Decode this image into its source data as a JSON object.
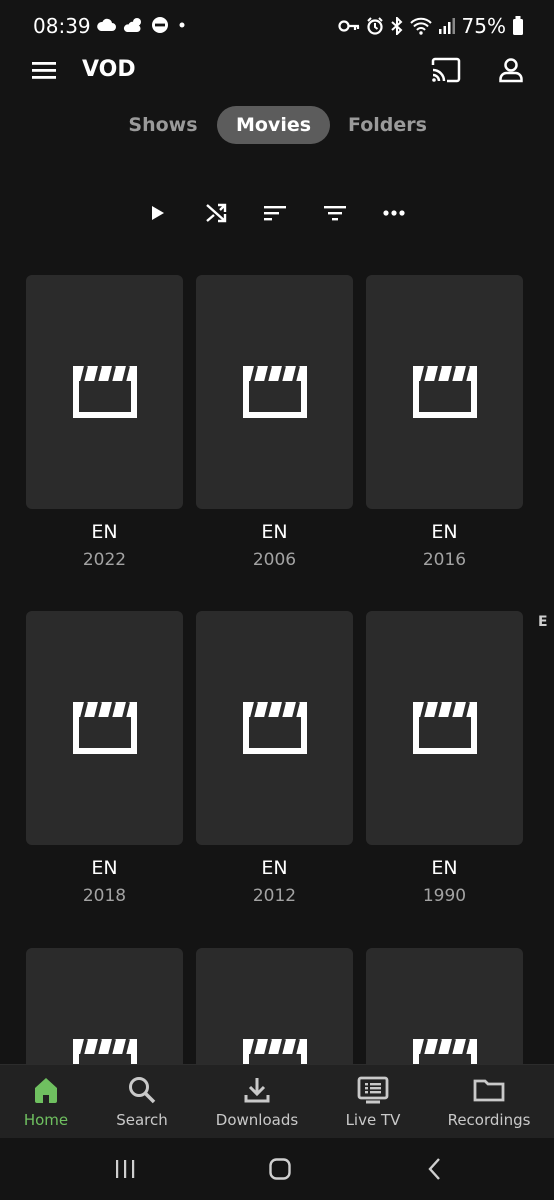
{
  "status_bar": {
    "time": "08:39",
    "battery": "75%"
  },
  "app_bar": {
    "title": "VOD"
  },
  "tabs": [
    {
      "label": "Shows",
      "active": false
    },
    {
      "label": "Movies",
      "active": true
    },
    {
      "label": "Folders",
      "active": false
    }
  ],
  "toolbar": {
    "icons": [
      "play-icon",
      "shuffle-icon",
      "sort-icon",
      "filter-icon",
      "more-icon"
    ]
  },
  "grid": {
    "items": [
      {
        "title": "EN",
        "year": "2022"
      },
      {
        "title": "EN",
        "year": "2006"
      },
      {
        "title": "EN",
        "year": "2016"
      },
      {
        "title": "EN",
        "year": "2018"
      },
      {
        "title": "EN",
        "year": "2012"
      },
      {
        "title": "EN",
        "year": "1990"
      },
      {
        "title": "",
        "year": ""
      },
      {
        "title": "",
        "year": ""
      },
      {
        "title": "",
        "year": ""
      }
    ]
  },
  "alpha_index": {
    "letter": "E"
  },
  "bottom_nav": {
    "items": [
      {
        "label": "Home",
        "active": true
      },
      {
        "label": "Search",
        "active": false
      },
      {
        "label": "Downloads",
        "active": false
      },
      {
        "label": "Live TV",
        "active": false
      },
      {
        "label": "Recordings",
        "active": false
      }
    ]
  },
  "colors": {
    "accent": "#6fc060",
    "background": "#141414",
    "card": "#2b2b2b",
    "active_tab": "#5c5c5c"
  }
}
